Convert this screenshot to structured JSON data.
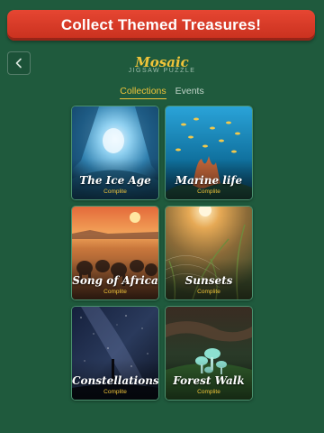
{
  "banner": {
    "text": "Collect Themed Treasures!"
  },
  "header": {
    "back_icon": "chevron-left-icon",
    "title": "Mosaic",
    "subtitle": "JIGSAW PUZZLE"
  },
  "tabs": [
    {
      "label": "Collections",
      "active": true
    },
    {
      "label": "Events",
      "active": false
    }
  ],
  "collections": [
    {
      "name": "The Ice Age",
      "status": "Complite"
    },
    {
      "name": "Marine life",
      "status": "Complite"
    },
    {
      "name": "Song of Africa",
      "status": "Complite"
    },
    {
      "name": "Sunsets",
      "status": "Complite"
    },
    {
      "name": "Constellations",
      "status": "Complite"
    },
    {
      "name": "Forest Walk",
      "status": "Complite"
    }
  ],
  "colors": {
    "background": "#1f5a3d",
    "banner": "#d93a26",
    "accent": "#f0c43a"
  }
}
